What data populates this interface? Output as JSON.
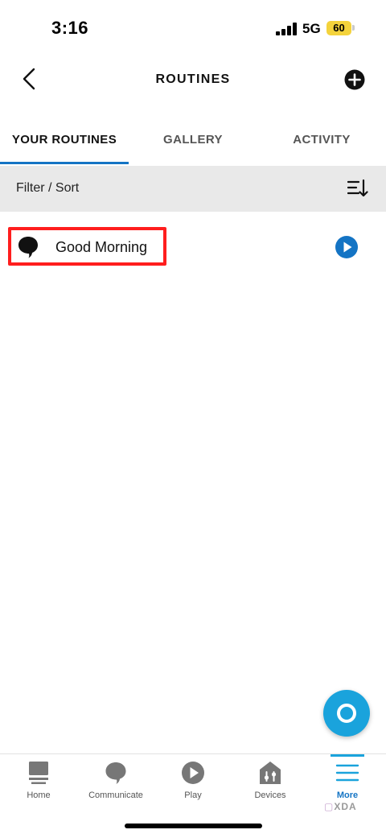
{
  "status_bar": {
    "time": "3:16",
    "network": "5G",
    "battery": "60",
    "battery_color": "#f4d33c"
  },
  "header": {
    "title": "ROUTINES",
    "back_icon": "chevron-left-icon",
    "add_icon": "plus-circle-icon"
  },
  "tabs": [
    {
      "label": "YOUR ROUTINES",
      "active": true
    },
    {
      "label": "GALLERY",
      "active": false
    },
    {
      "label": "ACTIVITY",
      "active": false
    }
  ],
  "filter": {
    "label": "Filter / Sort",
    "icon": "sort-icon"
  },
  "routines": [
    {
      "name": "Good Morning",
      "icon": "speech-bubble-icon",
      "action_icon": "play-icon",
      "highlighted": true
    }
  ],
  "bottom_nav": [
    {
      "label": "Home",
      "icon": "home-icon",
      "active": false
    },
    {
      "label": "Communicate",
      "icon": "communicate-icon",
      "active": false
    },
    {
      "label": "Play",
      "icon": "play-icon",
      "active": false
    },
    {
      "label": "Devices",
      "icon": "devices-icon",
      "active": false
    },
    {
      "label": "More",
      "icon": "menu-icon",
      "active": true
    }
  ],
  "watermark": {
    "mark": "▢",
    "text": "XDA"
  },
  "colors": {
    "accent": "#1474c4",
    "alexa_blue": "#1aa3dc",
    "highlight_red": "#ff1e1e",
    "filter_bg": "#e9e9e9"
  }
}
